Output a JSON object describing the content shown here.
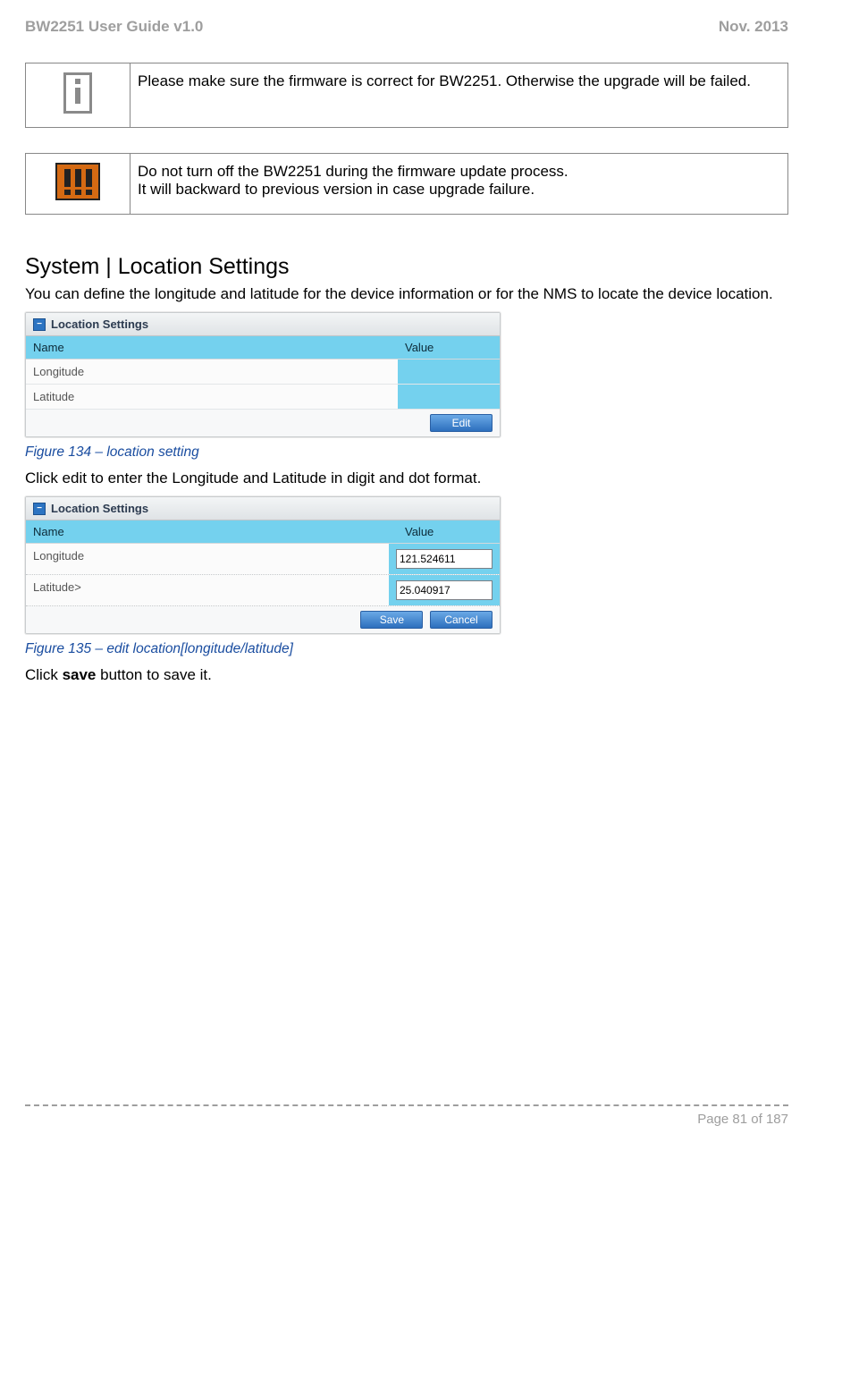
{
  "header": {
    "left": "BW2251 User Guide v1.0",
    "right": "Nov.  2013"
  },
  "notes": {
    "info": "Please make sure the firmware is correct for BW2251. Otherwise the upgrade will be failed.",
    "warn_line1": "Do not turn off the BW2251 during the firmware update process.",
    "warn_line2": "It will backward to previous version in case upgrade failure."
  },
  "section": {
    "title": "System | Location Settings",
    "intro": "You can define the longitude and latitude for the device information or for the NMS to locate the device location.",
    "fig134": "Figure 134 – location setting",
    "mid_text": "Click edit to enter the Longitude and Latitude in digit and dot format.",
    "fig135": "Figure 135 – edit location[longitude/latitude]",
    "save_text_pre": "Click ",
    "save_text_bold": "save",
    "save_text_post": " button to save it."
  },
  "panel1": {
    "title": "Location Settings",
    "col_name": "Name",
    "col_value": "Value",
    "rows": [
      {
        "name": "Longitude",
        "value": ""
      },
      {
        "name": "Latitude",
        "value": ""
      }
    ],
    "btn_edit": "Edit"
  },
  "panel2": {
    "title": "Location Settings",
    "col_name": "Name",
    "col_value": "Value",
    "rows": [
      {
        "name": "Longitude",
        "value": "121.524611"
      },
      {
        "name": "Latitude>",
        "value": "25.040917"
      }
    ],
    "btn_save": "Save",
    "btn_cancel": "Cancel"
  },
  "footer": {
    "page": "Page 81 of 187"
  }
}
